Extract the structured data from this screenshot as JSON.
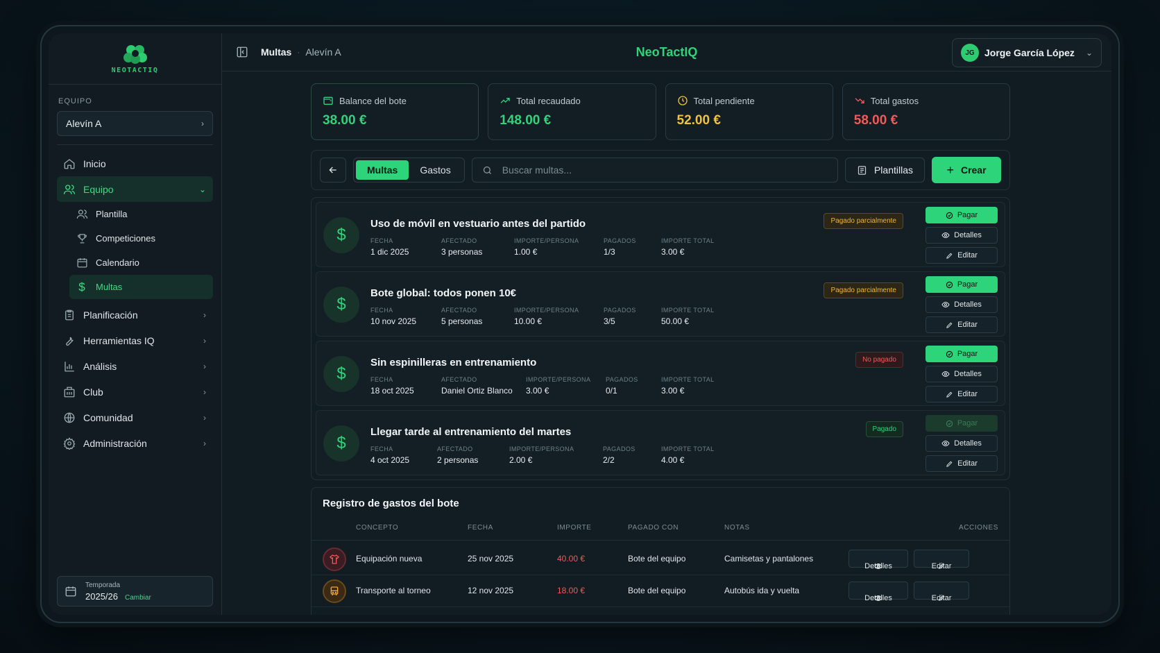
{
  "brand": {
    "logo_text": "NEOTACTIQ",
    "app_title": "NeoTactIQ"
  },
  "sidebar": {
    "section_label": "EQUIPO",
    "team_select": "Alevín A",
    "items": [
      {
        "label": "Inicio",
        "icon": "home-icon"
      },
      {
        "label": "Equipo",
        "icon": "users-icon"
      },
      {
        "label": "Planificación",
        "icon": "clipboard-icon"
      },
      {
        "label": "Herramientas IQ",
        "icon": "wrench-icon"
      },
      {
        "label": "Análisis",
        "icon": "bar-chart-icon"
      },
      {
        "label": "Club",
        "icon": "building-icon"
      },
      {
        "label": "Comunidad",
        "icon": "globe-icon"
      },
      {
        "label": "Administración",
        "icon": "gear-icon"
      }
    ],
    "sub_items": [
      {
        "label": "Plantilla",
        "icon": "users-icon"
      },
      {
        "label": "Competiciones",
        "icon": "trophy-icon"
      },
      {
        "label": "Calendario",
        "icon": "calendar-icon"
      },
      {
        "label": "Multas",
        "icon": "dollar-icon"
      }
    ],
    "season": {
      "label": "Temporada",
      "value": "2025/26",
      "change": "Cambiar"
    }
  },
  "header": {
    "breadcrumb": [
      "Multas",
      "Alevín A"
    ],
    "user": {
      "initials": "JG",
      "name": "Jorge García López"
    }
  },
  "stats": [
    {
      "label": "Balance del bote",
      "value": "38.00 €",
      "color": "#34d17c"
    },
    {
      "label": "Total recaudado",
      "value": "148.00 €",
      "color": "#34d17c"
    },
    {
      "label": "Total pendiente",
      "value": "52.00 €",
      "color": "#f3c13a"
    },
    {
      "label": "Total gastos",
      "value": "58.00 €",
      "color": "#f05a5a"
    }
  ],
  "toolbar": {
    "tabs": [
      "Multas",
      "Gastos"
    ],
    "search_placeholder": "Buscar multas...",
    "templates_label": "Plantillas",
    "create_label": "Crear"
  },
  "fines": [
    {
      "title": "Uso de móvil en vestuario antes del partido",
      "status": "Pagado parcialmente",
      "fields": [
        {
          "k": "FECHA",
          "v": "1 dic 2025"
        },
        {
          "k": "AFECTADO",
          "v": "3 personas"
        },
        {
          "k": "IMPORTE/PERSONA",
          "v": "1.00 €"
        },
        {
          "k": "PAGADOS",
          "v": "1/3"
        },
        {
          "k": "IMPORTE TOTAL",
          "v": "3.00 €"
        }
      ]
    },
    {
      "title": "Bote global: todos ponen 10€",
      "status": "Pagado parcialmente",
      "fields": [
        {
          "k": "FECHA",
          "v": "10 nov 2025"
        },
        {
          "k": "AFECTADO",
          "v": "5 personas"
        },
        {
          "k": "IMPORTE/PERSONA",
          "v": "10.00 €"
        },
        {
          "k": "PAGADOS",
          "v": "3/5"
        },
        {
          "k": "IMPORTE TOTAL",
          "v": "50.00 €"
        }
      ]
    },
    {
      "title": "Sin espinilleras en entrenamiento",
      "status": "No pagado",
      "fields": [
        {
          "k": "FECHA",
          "v": "18 oct 2025"
        },
        {
          "k": "AFECTADO",
          "v": "Daniel Ortiz Blanco"
        },
        {
          "k": "IMPORTE/PERSONA",
          "v": "3.00 €"
        },
        {
          "k": "PAGADOS",
          "v": "0/1"
        },
        {
          "k": "IMPORTE TOTAL",
          "v": "3.00 €"
        }
      ]
    },
    {
      "title": "Llegar tarde al entrenamiento del martes",
      "status": "Pagado",
      "fields": [
        {
          "k": "FECHA",
          "v": "4 oct 2025"
        },
        {
          "k": "AFECTADO",
          "v": "2 personas"
        },
        {
          "k": "IMPORTE/PERSONA",
          "v": "2.00 €"
        },
        {
          "k": "PAGADOS",
          "v": "2/2"
        },
        {
          "k": "IMPORTE TOTAL",
          "v": "4.00 €"
        }
      ]
    }
  ],
  "fine_actions": {
    "pay": "Pagar",
    "details": "Detalles",
    "edit": "Editar"
  },
  "expenses": {
    "title": "Registro de gastos del bote",
    "columns": [
      "CONCEPTO",
      "FECHA",
      "IMPORTE",
      "PAGADO CON",
      "NOTAS",
      "ACCIONES"
    ],
    "rows": [
      {
        "concept": "Equipación nueva",
        "date": "25 nov 2025",
        "amount": "40.00 €",
        "paid_with": "Bote del equipo",
        "notes": "Camisetas y pantalones",
        "icon": "shirt-icon"
      },
      {
        "concept": "Transporte al torneo",
        "date": "12 nov 2025",
        "amount": "18.00 €",
        "paid_with": "Bote del equipo",
        "notes": "Autobús ida y vuelta",
        "icon": "bus-icon"
      }
    ]
  }
}
